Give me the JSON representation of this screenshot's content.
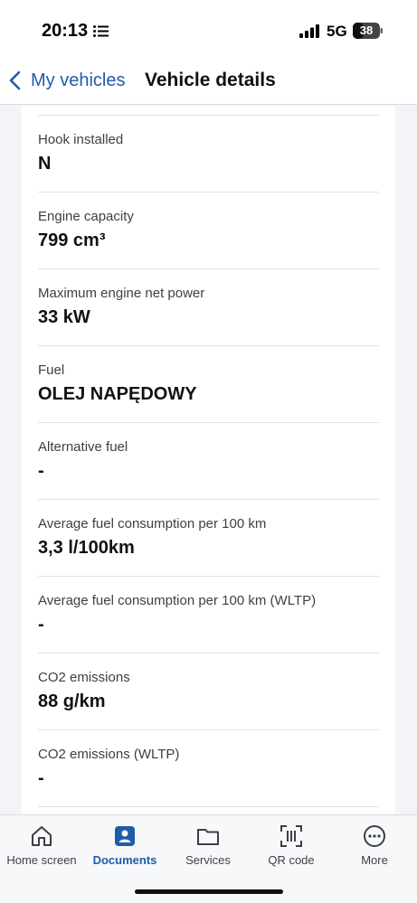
{
  "status_bar": {
    "time": "20:13",
    "network": "5G",
    "battery": "38"
  },
  "header": {
    "back_label": "My vehicles",
    "title": "Vehicle details"
  },
  "details": [
    {
      "label": "Hook installed",
      "value": "N"
    },
    {
      "label": "Engine capacity",
      "value": "799 cm³"
    },
    {
      "label": "Maximum engine net power",
      "value": "33 kW"
    },
    {
      "label": "Fuel",
      "value": "OLEJ NAPĘDOWY"
    },
    {
      "label": "Alternative fuel",
      "value": "-"
    },
    {
      "label": "Average fuel consumption per 100 km",
      "value": "3,3 l/100km"
    },
    {
      "label": "Average fuel consumption per 100 km (WLTP)",
      "value": "-"
    },
    {
      "label": "CO2 emissions",
      "value": "88 g/km"
    },
    {
      "label": "CO2 emissions (WLTP)",
      "value": "-"
    }
  ],
  "tabs": [
    {
      "label": "Home screen",
      "icon": "home-icon"
    },
    {
      "label": "Documents",
      "icon": "document-id-icon",
      "active": true
    },
    {
      "label": "Services",
      "icon": "folder-icon"
    },
    {
      "label": "QR code",
      "icon": "qr-scan-icon"
    },
    {
      "label": "More",
      "icon": "more-icon"
    }
  ],
  "colors": {
    "accent": "#1f5da8",
    "background": "#f2f4f7"
  }
}
